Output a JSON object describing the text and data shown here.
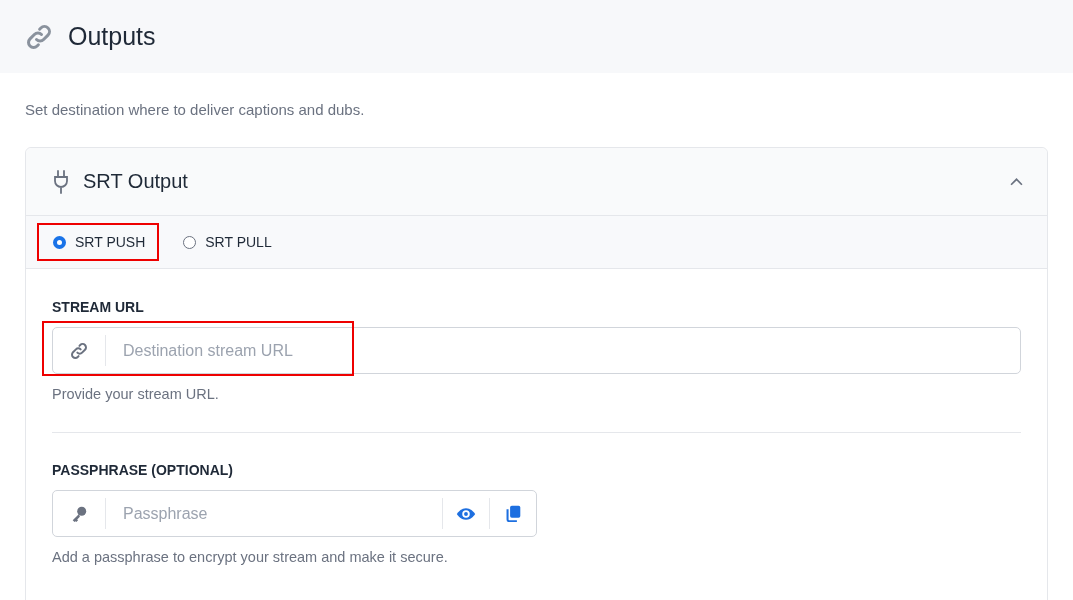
{
  "page": {
    "title": "Outputs",
    "description": "Set destination where to deliver captions and dubs."
  },
  "card": {
    "title": "SRT Output",
    "expanded": true,
    "modes": [
      {
        "label": "SRT PUSH",
        "selected": true,
        "highlighted": true
      },
      {
        "label": "SRT PULL",
        "selected": false,
        "highlighted": false
      }
    ],
    "fields": [
      {
        "kind": "url",
        "label": "STREAM URL",
        "placeholder": "Destination stream URL",
        "help": "Provide your stream URL.",
        "highlighted": true
      },
      {
        "kind": "secret",
        "label": "PASSPHRASE (OPTIONAL)",
        "placeholder": "Passphrase",
        "help": "Add a passphrase to encrypt your stream and make it secure.",
        "highlighted": false
      }
    ]
  }
}
